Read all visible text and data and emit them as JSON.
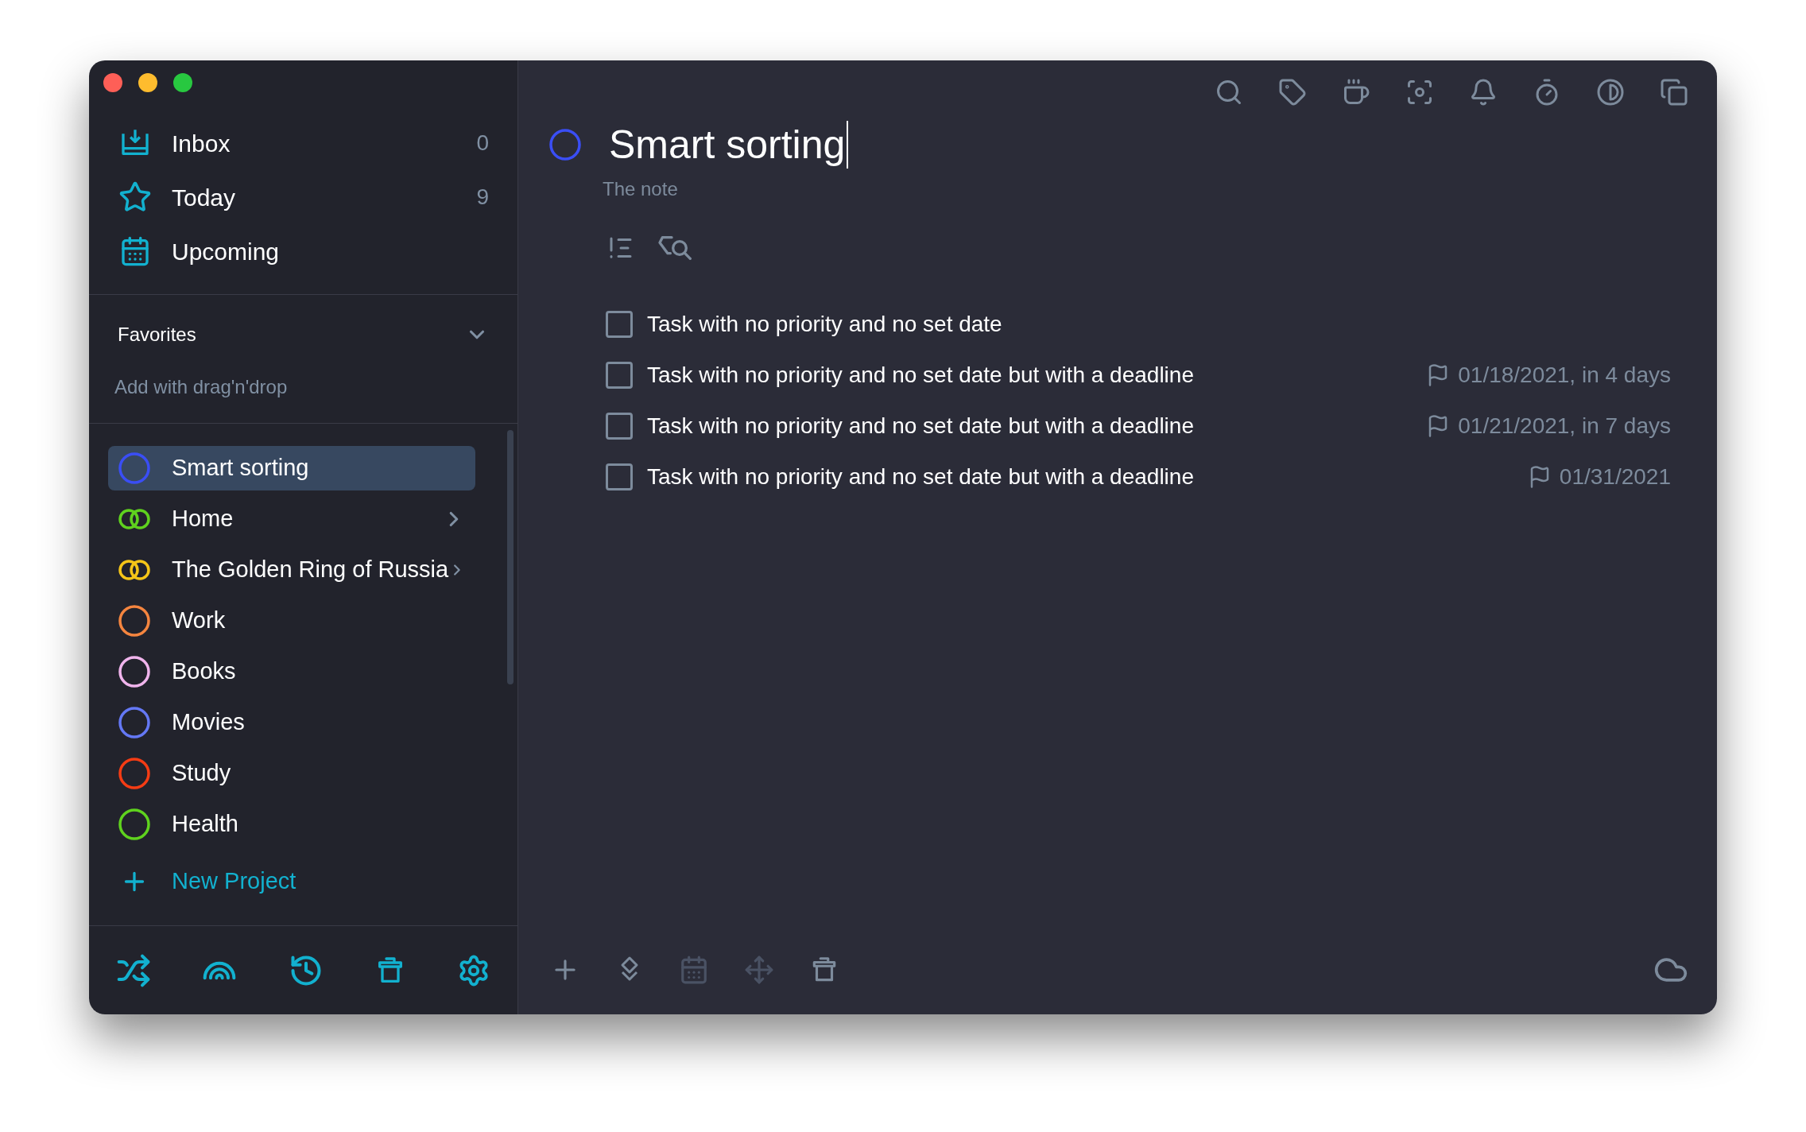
{
  "sidebar": {
    "smart_lists": [
      {
        "label": "Inbox",
        "count": "0"
      },
      {
        "label": "Today",
        "count": "9"
      },
      {
        "label": "Upcoming"
      }
    ],
    "favorites": {
      "title": "Favorites",
      "expanded": true,
      "hint": "Add with drag'n'drop"
    },
    "projects": [
      {
        "label": "Smart sorting",
        "kind": "circle",
        "color": "#3a4ef5",
        "selected": true,
        "has_children": false
      },
      {
        "label": "Home",
        "kind": "rings",
        "color": "#5fd21e",
        "selected": false,
        "has_children": true
      },
      {
        "label": "The Golden Ring of Russia",
        "kind": "rings",
        "color": "#f5c518",
        "selected": false,
        "has_children": true
      },
      {
        "label": "Work",
        "kind": "circle",
        "color": "#f5853f",
        "selected": false,
        "has_children": false
      },
      {
        "label": "Books",
        "kind": "circle",
        "color": "#f0b4ec",
        "selected": false,
        "has_children": false
      },
      {
        "label": "Movies",
        "kind": "circle",
        "color": "#6478f5",
        "selected": false,
        "has_children": false
      },
      {
        "label": "Study",
        "kind": "circle",
        "color": "#f53c14",
        "selected": false,
        "has_children": false
      },
      {
        "label": "Health",
        "kind": "circle",
        "color": "#5fd21e",
        "selected": false,
        "has_children": false
      }
    ],
    "new_project": "New Project"
  },
  "main": {
    "title": "Smart sorting",
    "note": "The note",
    "tasks": [
      {
        "title": "Task with no priority and no set date",
        "checked": false
      },
      {
        "title": "Task with no priority and no set date but with a deadline",
        "checked": false,
        "deadline": "01/18/2021, in 4 days"
      },
      {
        "title": "Task with no priority and no set date but with a deadline",
        "checked": false,
        "deadline": "01/21/2021, in 7 days"
      },
      {
        "title": "Task with no priority and no set date but with a deadline",
        "checked": false,
        "deadline": "01/31/2021"
      }
    ],
    "bottom_toolbar": [
      {
        "kind": "add",
        "disabled": false
      },
      {
        "kind": "priority",
        "disabled": false
      },
      {
        "kind": "calendar",
        "disabled": true
      },
      {
        "kind": "move",
        "disabled": true
      },
      {
        "kind": "trash",
        "disabled": false
      }
    ]
  }
}
